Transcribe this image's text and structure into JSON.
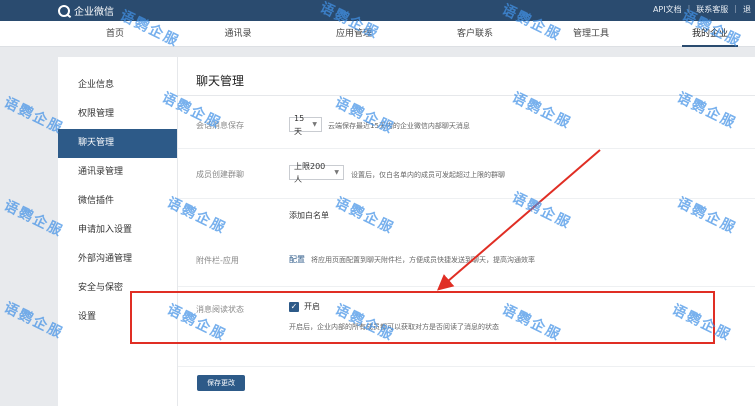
{
  "topbar": {
    "logo_text": "企业微信",
    "links": [
      "API文档",
      "联系客服",
      "退"
    ]
  },
  "nav": {
    "items": [
      "首页",
      "通讯录",
      "应用管理",
      "客户联系",
      "管理工具",
      "我的企业"
    ],
    "active_index": 5
  },
  "sidebar": {
    "items": [
      "企业信息",
      "权限管理",
      "聊天管理",
      "通讯录管理",
      "微信插件",
      "申请加入设置",
      "外部沟通管理",
      "安全与保密",
      "设置"
    ],
    "active_index": 2
  },
  "main": {
    "title": "聊天管理",
    "rows": {
      "save": {
        "label": "会话消息保存",
        "select_value": "15天",
        "desc": "云端保存最近15天内的企业微信内部聊天消息"
      },
      "group": {
        "label": "成员创建群聊",
        "select_value": "上限200人",
        "desc": "设置后，仅白名单内的成员可发起超过上限的群聊"
      },
      "whitelist": {
        "link": "添加白名单"
      },
      "attachment": {
        "label": "附件栏-应用",
        "link": "配置",
        "desc": "将应用页面配置到聊天附件栏，方便成员快捷发送到聊天，提高沟通效率"
      },
      "read_status": {
        "label": "消息阅读状态",
        "checkbox_label": "开启",
        "checked": true,
        "desc": "开启后，企业内部的所有成员都可以获取对方是否阅读了消息的状态"
      }
    },
    "save_button": "保存更改"
  },
  "watermark_text": "语鹦企服",
  "colors": {
    "topbar": "#2a4b6f",
    "active": "#2d5a88",
    "highlight": "#e02e24",
    "watermark": "#4291e6"
  }
}
